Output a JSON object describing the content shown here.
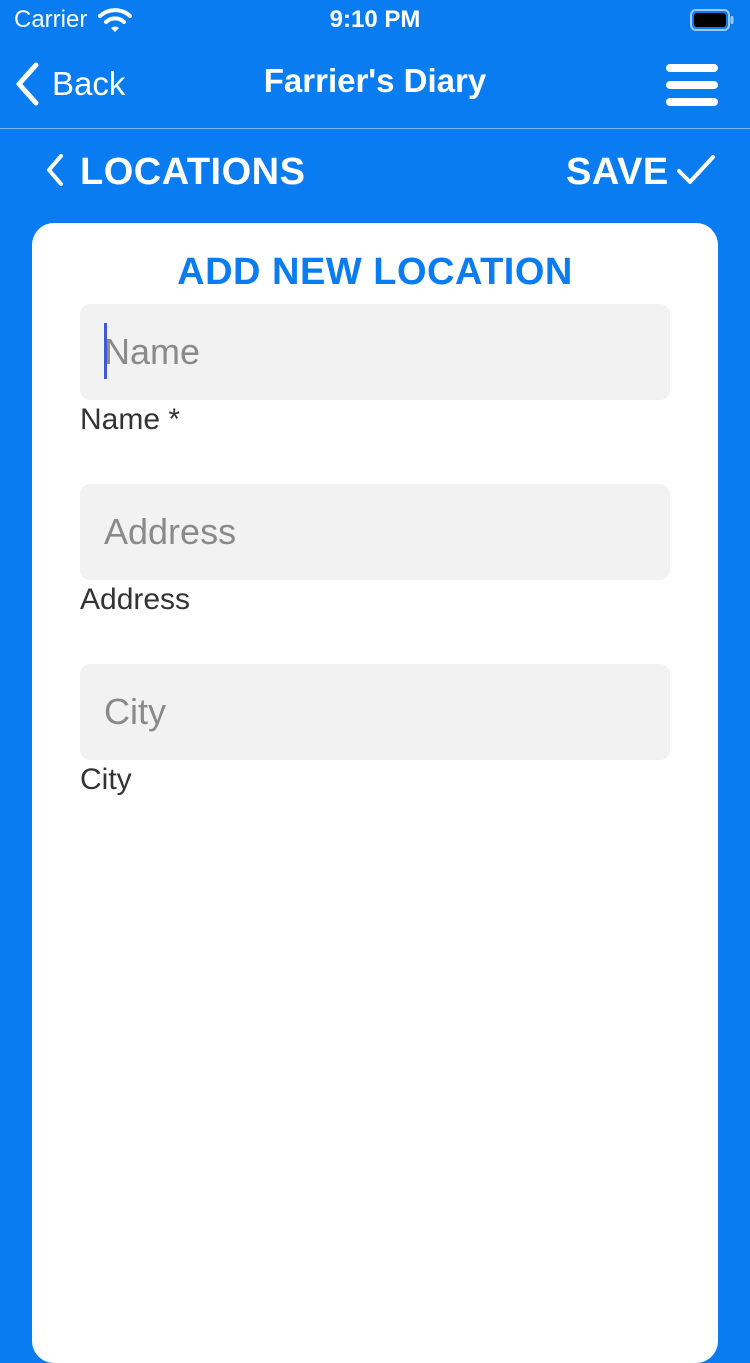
{
  "status_bar": {
    "carrier": "Carrier",
    "time": "9:10 PM",
    "wifi_icon": "wifi-icon",
    "battery_icon": "battery-icon"
  },
  "nav_bar": {
    "back_label": "Back",
    "title": "Farrier's Diary",
    "menu_icon": "hamburger-menu-icon"
  },
  "sub_header": {
    "back_label": "LOCATIONS",
    "save_label": "SAVE",
    "save_icon": "checkmark-icon"
  },
  "form": {
    "heading": "ADD NEW LOCATION",
    "fields": [
      {
        "placeholder": "Name",
        "value": "",
        "label": "Name *"
      },
      {
        "placeholder": "Address",
        "value": "",
        "label": "Address"
      },
      {
        "placeholder": "City",
        "value": "",
        "label": "City"
      }
    ]
  },
  "colors": {
    "brand_blue": "#0a7cf2",
    "card_background": "#ffffff",
    "field_background": "#f2f2f2",
    "caret": "#3b5bdb"
  }
}
